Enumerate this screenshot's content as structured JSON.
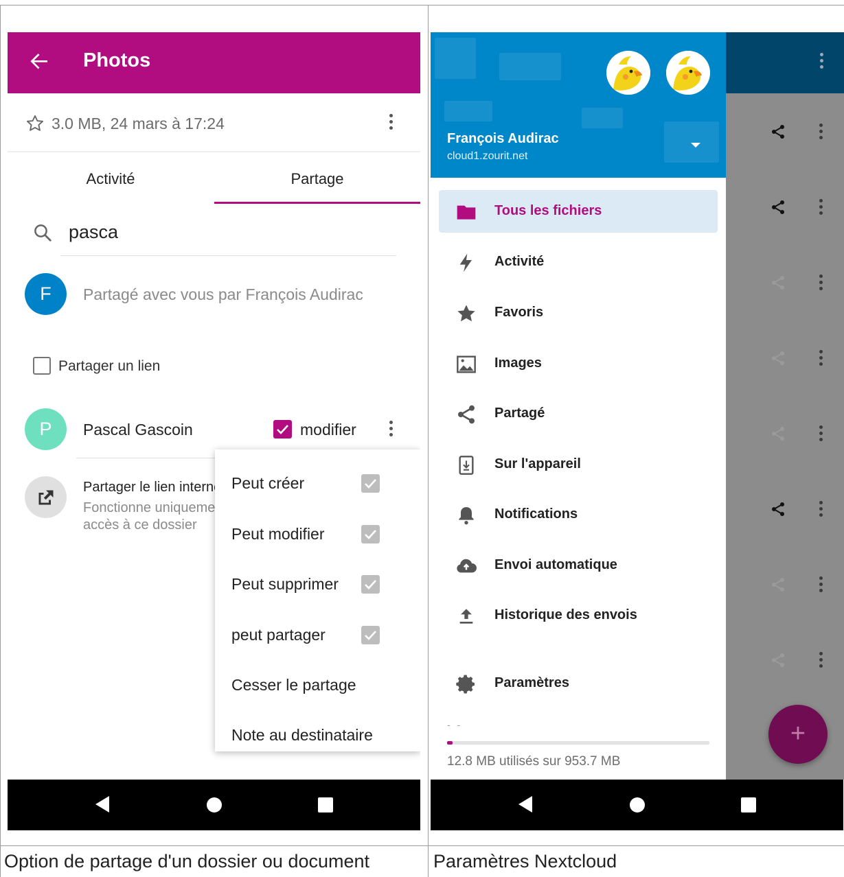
{
  "captions": {
    "left": "Option de partage d'un dossier ou document",
    "right": "Paramètres Nextcloud"
  },
  "left_screen": {
    "appbar": {
      "title": "Photos",
      "color": "#b10c80"
    },
    "file_info": "3.0 MB, 24 mars à 17:24",
    "tabs": [
      "Activité",
      "Partage"
    ],
    "active_tab": "Partage",
    "search": {
      "value": "pasca"
    },
    "shared_by": {
      "initial": "F",
      "text": "Partagé avec vous par François Audirac",
      "color": "#0082c9"
    },
    "share_link": {
      "label": "Partager un lien",
      "checked": false
    },
    "sharee": {
      "initial": "P",
      "name": "Pascal Gascoin",
      "permission_label": "modifier",
      "checked": true,
      "color": "#6ee0c0"
    },
    "internal_link": {
      "title": "Partager le lien interne",
      "line1": "Fonctionne uniquement pour les utilisateurs ayant",
      "line2": "accès à ce dossier"
    },
    "menu": [
      {
        "label": "Peut créer",
        "checked": true
      },
      {
        "label": "Peut modifier",
        "checked": true
      },
      {
        "label": "Peut supprimer",
        "checked": true
      },
      {
        "label": "peut partager",
        "checked": true
      },
      {
        "label": "Cesser le partage"
      },
      {
        "label": "Note au destinataire"
      }
    ]
  },
  "right_screen": {
    "account": {
      "name": "François Audirac",
      "host": "cloud1.zourit.net",
      "header_color": "#0087c9"
    },
    "nav": [
      {
        "label": "Tous les fichiers",
        "icon": "folder-icon",
        "active": true
      },
      {
        "label": "Activité",
        "icon": "lightning-icon"
      },
      {
        "label": "Favoris",
        "icon": "star-icon"
      },
      {
        "label": "Images",
        "icon": "image-icon"
      },
      {
        "label": "Partagé",
        "icon": "share-icon"
      },
      {
        "label": "Sur l'appareil",
        "icon": "device-icon"
      },
      {
        "label": "Notifications",
        "icon": "bell-icon"
      },
      {
        "label": "Envoi automatique",
        "icon": "cloud-upload-icon"
      },
      {
        "label": "Historique des envois",
        "icon": "upload-icon"
      },
      {
        "label": "Paramètres",
        "icon": "gear-icon"
      }
    ],
    "quota": {
      "dash": "- -",
      "text": "12.8 MB utilisés sur 953.7 MB",
      "fraction": 0.013
    },
    "fab_label": "+"
  }
}
